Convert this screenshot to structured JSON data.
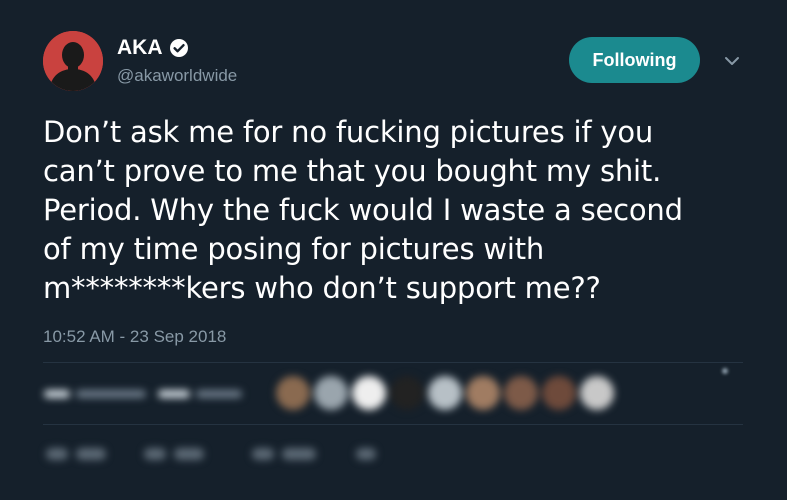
{
  "user": {
    "display_name": "AKA",
    "handle": "@akaworldwide",
    "verified": true,
    "avatar_color": "#c9423f"
  },
  "follow_button": {
    "label": "Following",
    "color": "#1b8a8f"
  },
  "menu": {
    "icon": "chevron-down-icon"
  },
  "tweet": {
    "text": "Don’t ask me for no fucking pictures if you\ncan’t prove to me that you bought my shit.\nPeriod. Why the fuck would I waste a second\nof my time posing for pictures with\nm********kers who don’t support me??",
    "timestamp": "10:52 AM - 23 Sep 2018"
  },
  "colors": {
    "background": "#15202b",
    "secondary_text": "#8899a6",
    "divider": "#253341"
  }
}
